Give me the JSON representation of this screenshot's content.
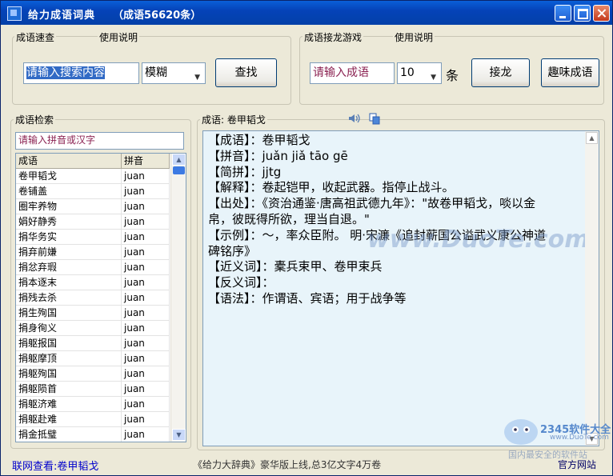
{
  "window": {
    "title": "给力成语词典",
    "title_count": "（成语56620条）"
  },
  "search_group": {
    "label": "成语速查",
    "help": "使用说明",
    "input_value": "请输入搜索内容",
    "mode": "模糊",
    "search_button": "查找"
  },
  "game_group": {
    "label": "成语接龙游戏",
    "help": "使用说明",
    "input_value": "请输入成语",
    "count": "10",
    "unit": "条",
    "chain_button": "接龙",
    "fun_button": "趣味成语"
  },
  "lookup_group": {
    "label": "成语检索",
    "input_value": "请输入拼音或汉字",
    "headers": {
      "idiom": "成语",
      "pinyin": "拼音"
    },
    "rows": [
      {
        "idiom": "卷甲韬戈",
        "pinyin": "juan"
      },
      {
        "idiom": "卷铺盖",
        "pinyin": "juan"
      },
      {
        "idiom": "圈牢养物",
        "pinyin": "juan"
      },
      {
        "idiom": "娟好静秀",
        "pinyin": "juan"
      },
      {
        "idiom": "捐华务实",
        "pinyin": "juan"
      },
      {
        "idiom": "捐弃前嫌",
        "pinyin": "juan"
      },
      {
        "idiom": "捐忿弃瑕",
        "pinyin": "juan"
      },
      {
        "idiom": "捐本逐末",
        "pinyin": "juan"
      },
      {
        "idiom": "捐残去杀",
        "pinyin": "juan"
      },
      {
        "idiom": "捐生殉国",
        "pinyin": "juan"
      },
      {
        "idiom": "捐身徇义",
        "pinyin": "juan"
      },
      {
        "idiom": "捐躯报国",
        "pinyin": "juan"
      },
      {
        "idiom": "捐躯摩顶",
        "pinyin": "juan"
      },
      {
        "idiom": "捐躯殉国",
        "pinyin": "juan"
      },
      {
        "idiom": "捐躯陨首",
        "pinyin": "juan"
      },
      {
        "idiom": "捐躯济难",
        "pinyin": "juan"
      },
      {
        "idiom": "捐躯赴难",
        "pinyin": "juan"
      },
      {
        "idiom": "捐金抵璧",
        "pinyin": "juan"
      }
    ]
  },
  "detail_group": {
    "label": "成语: 卷甲韬戈",
    "speaker_icon": "speaker-icon",
    "copy_icon": "copy-icon",
    "lines": [
      "【成语】：卷甲韬戈",
      "【拼音】：juǎn jiǎ tāo gē",
      "【简拼】：jjtg",
      "【解释】：卷起铠甲，收起武器。指停止战斗。",
      "【出处】：《资治通鉴·唐高祖武德九年》：\"故卷甲韬戈，啖以金",
      "帛，彼既得所欲，理当自退。\"",
      "【示例】：～，率众臣附。 明·宋濂《追封蕲国公谥武义康公神道",
      "碑铭序》",
      "【近义词】：橐兵束甲、卷甲束兵",
      "【反义词】：",
      "【语法】：作谓语、宾语；用于战争等"
    ]
  },
  "status": {
    "left": "联网查看:卷甲韬戈",
    "middle": "《给力大辞典》豪华版上线,总3亿文字4万卷",
    "right": "官方网站"
  },
  "watermark": {
    "text": "www.DuoTe.com",
    "brand": "2345软件大全",
    "brand_url": "www.DuoTe.com",
    "brand_slogan": "国内最安全的软件站"
  }
}
